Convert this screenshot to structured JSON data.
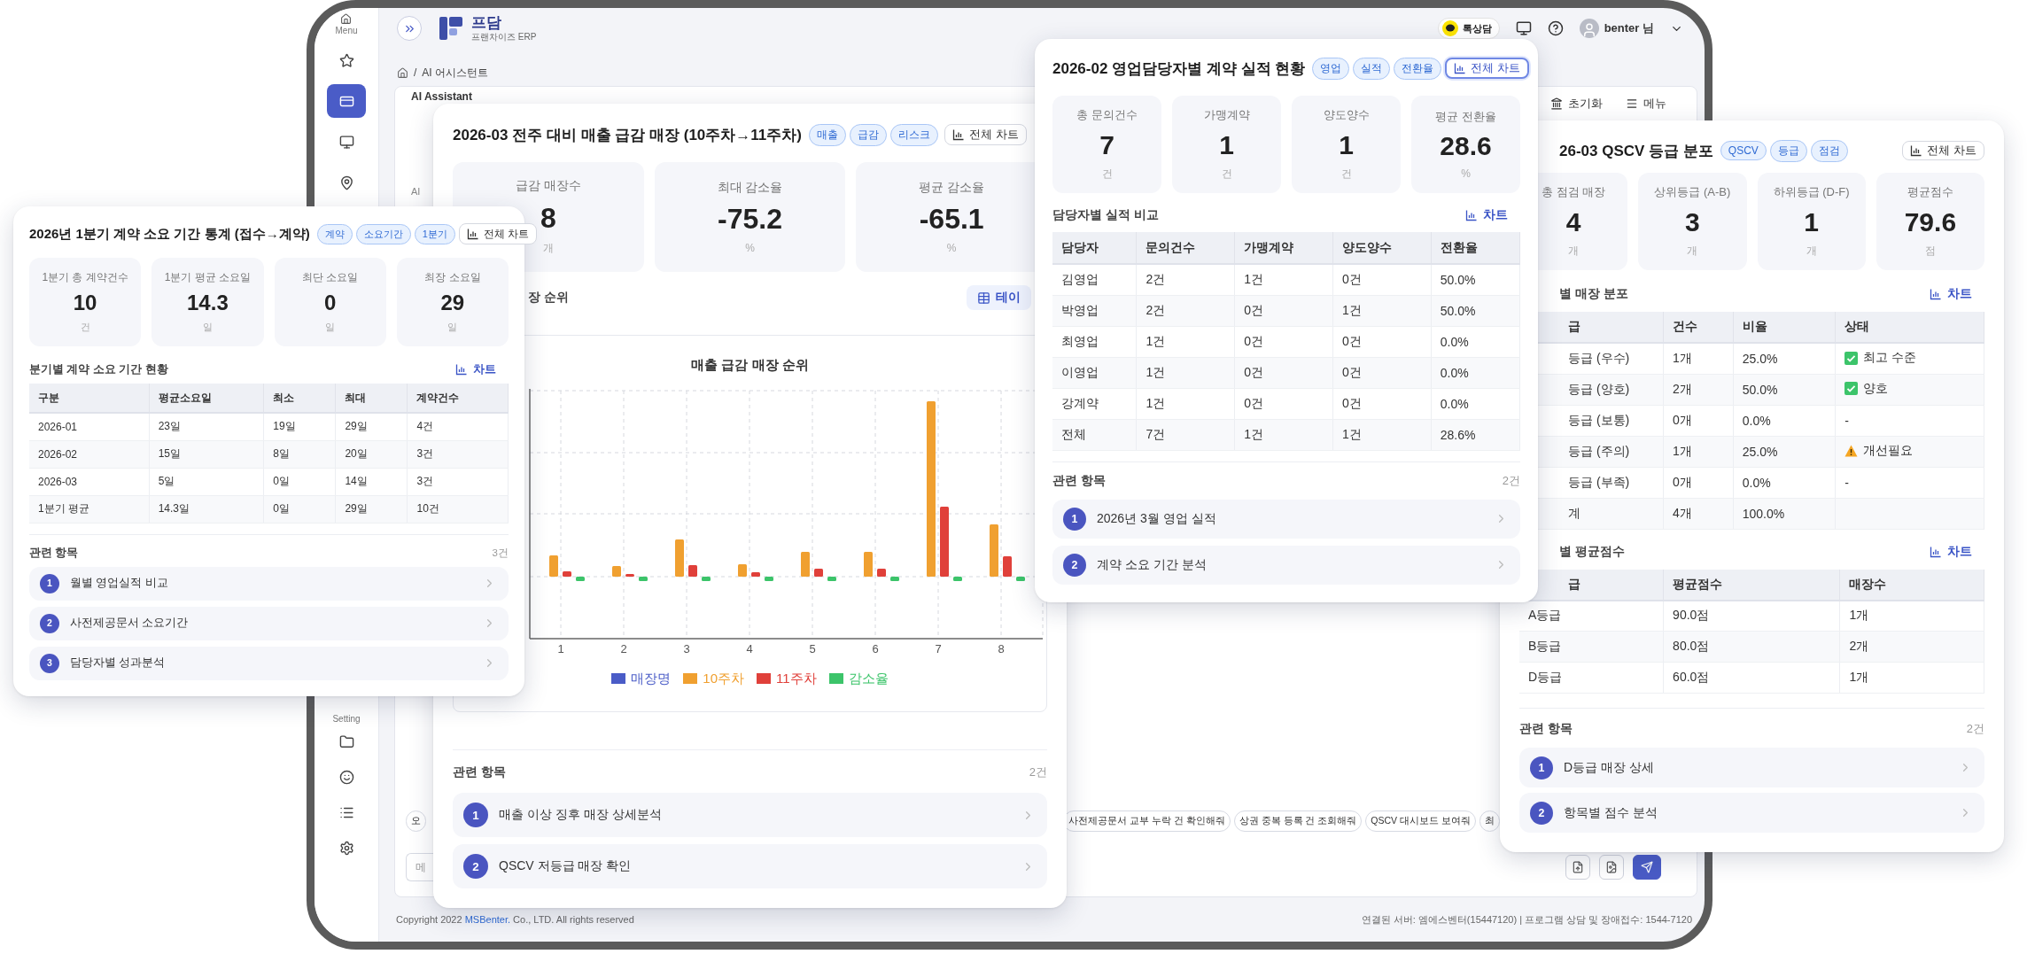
{
  "app": {
    "header": {
      "logo_text": "프담",
      "logo_subtext": "프랜차이즈 ERP",
      "chat_button": "톡상담",
      "user_name": "benter 님"
    },
    "sidebar": {
      "menu_label": "Menu",
      "top_items": [
        {
          "kind": "star",
          "selected": false
        },
        {
          "kind": "card",
          "selected": true
        },
        {
          "kind": "monitor",
          "selected": false
        },
        {
          "kind": "pin",
          "selected": false
        }
      ],
      "section_label": "Setting",
      "bottom_items": [
        {
          "kind": "folder",
          "selected": false
        },
        {
          "kind": "smile",
          "selected": false
        },
        {
          "kind": "list",
          "selected": false
        },
        {
          "kind": "gear",
          "selected": false
        }
      ]
    },
    "breadcrumb": {
      "separator": "/",
      "items": [
        "AI 어시스턴트"
      ]
    },
    "panel": {
      "title": "AI Assistant",
      "toolbar": [
        {
          "kind": "reset",
          "label": "초기화"
        },
        {
          "kind": "menu",
          "label": "메뉴"
        }
      ],
      "side_label": "AI",
      "suggestions": [
        "오",
        "사전제공문서 교부 누락 건 확인해줘",
        "상권 중복 등록 건 조회해줘",
        "QSCV 대시보드 보여줘",
        "최"
      ],
      "input": {
        "placeholder": "메"
      }
    },
    "footer": {
      "copyright_start": "Copyright 2022",
      "company_link": "MSBenter.",
      "copyright_end": "Co., LTD. All rights reserved",
      "server_info": "연결된 서버: 엠에스벤터(15447120) | 프로그램 상담 및 장애접수: 1544-7120"
    }
  },
  "cards": {
    "sales_rep_card": {
      "title": "2026-02 영업담당자별 계약 실적 현황",
      "tags": [
        "영업",
        "실적",
        "전환율"
      ],
      "chart_button": {
        "label": "전체 차트",
        "active": true
      },
      "stats": [
        {
          "label": "총 문의건수",
          "value": "7",
          "unit": "건"
        },
        {
          "label": "가맹계약",
          "value": "1",
          "unit": "건"
        },
        {
          "label": "양도양수",
          "value": "1",
          "unit": "건"
        },
        {
          "label": "평균 전환율",
          "value": "28.6",
          "unit": "%"
        }
      ],
      "sections": [
        {
          "kind": "table",
          "heading": "담당자별 실적 비교",
          "action": "차트",
          "columns": [
            "담당자",
            "문의건수",
            "가맹계약",
            "양도양수",
            "전환율"
          ],
          "rows": [
            [
              "김영업",
              "2건",
              "1건",
              "0건",
              "50.0%"
            ],
            [
              "박영업",
              "2건",
              "0건",
              "1건",
              "50.0%"
            ],
            [
              "최영업",
              "1건",
              "0건",
              "0건",
              "0.0%"
            ],
            [
              "이영업",
              "1건",
              "0건",
              "0건",
              "0.0%"
            ],
            [
              "강계약",
              "1건",
              "0건",
              "0건",
              "0.0%"
            ],
            [
              "전체",
              "7건",
              "1건",
              "1건",
              "28.6%"
            ]
          ]
        }
      ],
      "related": {
        "heading": "관련 항목",
        "count": "2건",
        "items": [
          {
            "number": "1",
            "label": "2026년 3월 영업 실적"
          },
          {
            "number": "2",
            "label": "계약 소요 기간 분석"
          }
        ]
      }
    },
    "sales_drop_card": {
      "title": "2026-03 전주 대비 매출 급감 매장 (10주차→11주차)",
      "tags": [
        "매출",
        "급감",
        "리스크"
      ],
      "chart_button": {
        "label": "전체 차트",
        "active": false
      },
      "stats": [
        {
          "label": "급감 매장수",
          "value": "8",
          "unit": "개"
        },
        {
          "label": "최대 감소율",
          "value": "-75.2",
          "unit": "%"
        },
        {
          "label": "평균 감소율",
          "value": "-65.1",
          "unit": "%"
        }
      ],
      "sections": [
        {
          "kind": "chart",
          "heading": "장 순위",
          "action": "테이",
          "chart": {
            "title": "매출 급감 매장 순위",
            "x_labels": [
              "1",
              "2",
              "3",
              "4",
              "5",
              "6",
              "7",
              "8"
            ],
            "legend": [
              {
                "label": "매장명",
                "color": "#4a5cc7"
              },
              {
                "label": "10주차",
                "color": "#f0a030"
              },
              {
                "label": "11주차",
                "color": "#e0403a"
              },
              {
                "label": "감소율",
                "color": "#3cc46a"
              }
            ]
          }
        }
      ],
      "related": {
        "heading": "관련 항목",
        "count": "2건",
        "items": [
          {
            "number": "1",
            "label": "매출 이상 징후 매장 상세분석"
          },
          {
            "number": "2",
            "label": "QSCV 저등급 매장 확인"
          }
        ]
      }
    },
    "qscv_card": {
      "title": "26-03 QSCV 등급 분포",
      "tags": [
        "QSCV",
        "등급",
        "점검"
      ],
      "chart_button": {
        "label": "전체 차트",
        "active": false
      },
      "stats": [
        {
          "label": "총 점검 매장",
          "value": "4",
          "unit": "개"
        },
        {
          "label": "상위등급 (A-B)",
          "value": "3",
          "unit": "개"
        },
        {
          "label": "하위등급 (D-F)",
          "value": "1",
          "unit": "개"
        },
        {
          "label": "평균점수",
          "value": "79.6",
          "unit": "점"
        }
      ],
      "sections": [
        {
          "kind": "table",
          "heading": "별 매장 분포",
          "action": "차트",
          "columns": [
            "급",
            "건수",
            "비율",
            "상태"
          ],
          "rows": [
            [
              "등급 (우수)",
              "1개",
              "25.0%",
              {
                "kind": "good",
                "text": "최고 수준"
              }
            ],
            [
              "등급 (양호)",
              "2개",
              "50.0%",
              {
                "kind": "good",
                "text": "양호"
              }
            ],
            [
              "등급 (보통)",
              "0개",
              "0.0%",
              "-"
            ],
            [
              "등급 (주의)",
              "1개",
              "25.0%",
              {
                "kind": "warning",
                "text": "개선필요"
              }
            ],
            [
              "등급 (부족)",
              "0개",
              "0.0%",
              "-"
            ],
            [
              "계",
              "4개",
              "100.0%"
            ]
          ]
        },
        {
          "kind": "table",
          "heading": "별 평균점수",
          "action": "차트",
          "columns": [
            "급",
            "평균점수",
            "매장수"
          ],
          "rows": [
            [
              "A등급",
              "90.0점",
              "1개"
            ],
            [
              "B등급",
              "80.0점",
              "2개"
            ],
            [
              "D등급",
              "60.0점",
              "1개"
            ]
          ]
        }
      ],
      "related": {
        "heading": "관련 항목",
        "count": "2건",
        "items": [
          {
            "number": "1",
            "label": "D등급 매장 상세"
          },
          {
            "number": "2",
            "label": "항목별 점수 분석"
          }
        ]
      }
    },
    "contract_period_card": {
      "title": "2026년 1분기 계약 소요 기간 통계 (접수→계약)",
      "tags": [
        "계약",
        "소요기간",
        "1분기"
      ],
      "chart_button": {
        "label": "전체 차트",
        "active": false
      },
      "stats": [
        {
          "label": "1분기 총 계약건수",
          "value": "10",
          "unit": "건"
        },
        {
          "label": "1분기 평균 소요일",
          "value": "14.3",
          "unit": "일"
        },
        {
          "label": "최단 소요일",
          "value": "0",
          "unit": "일"
        },
        {
          "label": "최장 소요일",
          "value": "29",
          "unit": "일"
        }
      ],
      "sections": [
        {
          "kind": "table",
          "heading": "분기별 계약 소요 기간 현황",
          "action": "차트",
          "columns": [
            "구분",
            "평균소요일",
            "최소",
            "최대",
            "계약건수"
          ],
          "rows": [
            [
              "2026-01",
              "23일",
              "19일",
              "29일",
              "4건"
            ],
            [
              "2026-02",
              "15일",
              "8일",
              "20일",
              "3건"
            ],
            [
              "2026-03",
              "5일",
              "0일",
              "14일",
              "3건"
            ],
            [
              "1분기 평균",
              "14.3일",
              "0일",
              "29일",
              "10건"
            ]
          ]
        }
      ],
      "related": {
        "heading": "관련 항목",
        "count": "3건",
        "items": [
          {
            "number": "1",
            "label": "월별 영업실적 비교"
          },
          {
            "number": "2",
            "label": "사전제공문서 소요기간"
          },
          {
            "number": "3",
            "label": "담당자별 성과분석"
          }
        ]
      }
    }
  }
}
